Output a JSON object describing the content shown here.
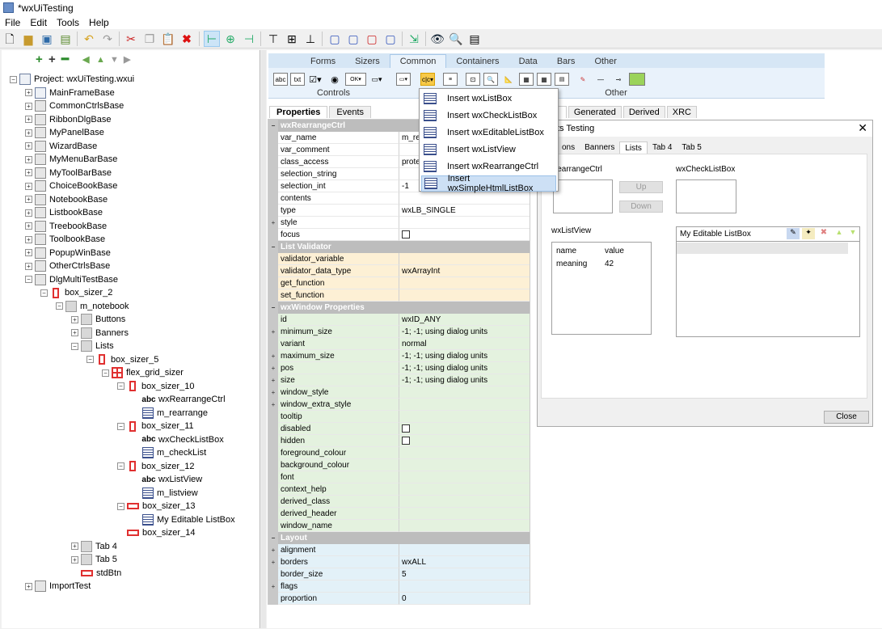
{
  "window": {
    "title": "*wxUiTesting"
  },
  "menu": [
    "File",
    "Edit",
    "Tools",
    "Help"
  ],
  "tree": [
    {
      "label": "Project: wxUiTesting.wxui",
      "depth": 0,
      "exp": "-",
      "icon": "form2"
    },
    {
      "label": "MainFrameBase",
      "depth": 1,
      "exp": "+",
      "icon": "form2"
    },
    {
      "label": "CommonCtrlsBase",
      "depth": 1,
      "exp": "+",
      "icon": "form"
    },
    {
      "label": "RibbonDlgBase",
      "depth": 1,
      "exp": "+",
      "icon": "form"
    },
    {
      "label": "MyPanelBase",
      "depth": 1,
      "exp": "+",
      "icon": "form"
    },
    {
      "label": "WizardBase",
      "depth": 1,
      "exp": "+",
      "icon": "form"
    },
    {
      "label": "MyMenuBarBase",
      "depth": 1,
      "exp": "+",
      "icon": "form"
    },
    {
      "label": "MyToolBarBase",
      "depth": 1,
      "exp": "+",
      "icon": "form"
    },
    {
      "label": "ChoiceBookBase",
      "depth": 1,
      "exp": "+",
      "icon": "form"
    },
    {
      "label": "NotebookBase",
      "depth": 1,
      "exp": "+",
      "icon": "form"
    },
    {
      "label": "ListbookBase",
      "depth": 1,
      "exp": "+",
      "icon": "form"
    },
    {
      "label": "TreebookBase",
      "depth": 1,
      "exp": "+",
      "icon": "form"
    },
    {
      "label": "ToolbookBase",
      "depth": 1,
      "exp": "+",
      "icon": "form"
    },
    {
      "label": "PopupWinBase",
      "depth": 1,
      "exp": "+",
      "icon": "form"
    },
    {
      "label": "OtherCtrlsBase",
      "depth": 1,
      "exp": "+",
      "icon": "form"
    },
    {
      "label": "DlgMultiTestBase",
      "depth": 1,
      "exp": "-",
      "icon": "form"
    },
    {
      "label": "box_sizer_2",
      "depth": 2,
      "exp": "-",
      "icon": "sizer"
    },
    {
      "label": "m_notebook",
      "depth": 3,
      "exp": "-",
      "icon": "folder"
    },
    {
      "label": "Buttons",
      "depth": 4,
      "exp": "+",
      "icon": "folder"
    },
    {
      "label": "Banners",
      "depth": 4,
      "exp": "+",
      "icon": "folder"
    },
    {
      "label": "Lists",
      "depth": 4,
      "exp": "-",
      "icon": "folder"
    },
    {
      "label": "box_sizer_5",
      "depth": 5,
      "exp": "-",
      "icon": "sizer"
    },
    {
      "label": "flex_grid_sizer",
      "depth": 6,
      "exp": "-",
      "icon": "grid"
    },
    {
      "label": "box_sizer_10",
      "depth": 7,
      "exp": "-",
      "icon": "sizer"
    },
    {
      "label": "wxRearrangeCtrl",
      "depth": 8,
      "exp": "",
      "icon": "abc"
    },
    {
      "label": "m_rearrange",
      "depth": 8,
      "exp": "",
      "icon": "list"
    },
    {
      "label": "box_sizer_11",
      "depth": 7,
      "exp": "-",
      "icon": "sizer"
    },
    {
      "label": "wxCheckListBox",
      "depth": 8,
      "exp": "",
      "icon": "abc"
    },
    {
      "label": "m_checkList",
      "depth": 8,
      "exp": "",
      "icon": "list"
    },
    {
      "label": "box_sizer_12",
      "depth": 7,
      "exp": "-",
      "icon": "sizer"
    },
    {
      "label": "wxListView",
      "depth": 8,
      "exp": "",
      "icon": "abc"
    },
    {
      "label": "m_listview",
      "depth": 8,
      "exp": "",
      "icon": "list"
    },
    {
      "label": "box_sizer_13",
      "depth": 7,
      "exp": "-",
      "icon": "hsizer"
    },
    {
      "label": "My Editable ListBox",
      "depth": 8,
      "exp": "",
      "icon": "list"
    },
    {
      "label": "box_sizer_14",
      "depth": 7,
      "exp": "",
      "icon": "hsizer"
    },
    {
      "label": "Tab 4",
      "depth": 4,
      "exp": "+",
      "icon": "folder"
    },
    {
      "label": "Tab 5",
      "depth": 4,
      "exp": "+",
      "icon": "folder"
    },
    {
      "label": "stdBtn",
      "depth": 4,
      "exp": "",
      "icon": "hsizer"
    },
    {
      "label": "ImportTest",
      "depth": 1,
      "exp": "+",
      "icon": "form"
    }
  ],
  "palette": {
    "tabs": [
      "Forms",
      "Sizers",
      "Common",
      "Containers",
      "Data",
      "Bars",
      "Other"
    ],
    "selected": "Common",
    "groups": [
      "Controls",
      "Other"
    ]
  },
  "prop_tabs": [
    "Properties",
    "Events"
  ],
  "props": [
    {
      "cat": "wxRearrangeCtrl"
    },
    {
      "n": "var_name",
      "v": "m_rea",
      "bg": "#fff"
    },
    {
      "n": "var_comment",
      "v": "",
      "bg": "#fff"
    },
    {
      "n": "class_access",
      "v": "protec",
      "bg": "#fff"
    },
    {
      "n": "selection_string",
      "v": "",
      "bg": "#fff"
    },
    {
      "n": "selection_int",
      "v": "-1",
      "bg": "#fff"
    },
    {
      "n": "contents",
      "v": "",
      "bg": "#fff"
    },
    {
      "n": "type",
      "v": "wxLB_SINGLE",
      "bg": "#fff"
    },
    {
      "n": "style",
      "v": "",
      "bg": "#fff",
      "g": "+"
    },
    {
      "n": "focus",
      "v": "",
      "bg": "#fff",
      "chk": true
    },
    {
      "cat": "List Validator"
    },
    {
      "n": "validator_variable",
      "v": "",
      "bg": "#fdf0d5"
    },
    {
      "n": "validator_data_type",
      "v": "wxArrayInt",
      "bg": "#fdf0d5"
    },
    {
      "n": "get_function",
      "v": "",
      "bg": "#fdf0d5"
    },
    {
      "n": "set_function",
      "v": "",
      "bg": "#fdf0d5"
    },
    {
      "cat": "wxWindow Properties"
    },
    {
      "n": "id",
      "v": "wxID_ANY",
      "bg": "#e4f2df"
    },
    {
      "n": "minimum_size",
      "v": "-1; -1; using dialog units",
      "bg": "#e4f2df",
      "g": "+"
    },
    {
      "n": "variant",
      "v": "normal",
      "bg": "#e4f2df"
    },
    {
      "n": "maximum_size",
      "v": "-1; -1; using dialog units",
      "bg": "#e4f2df",
      "g": "+"
    },
    {
      "n": "pos",
      "v": "-1; -1; using dialog units",
      "bg": "#e4f2df",
      "g": "+"
    },
    {
      "n": "size",
      "v": "-1; -1; using dialog units",
      "bg": "#e4f2df",
      "g": "+"
    },
    {
      "n": "window_style",
      "v": "",
      "bg": "#e4f2df",
      "g": "+"
    },
    {
      "n": "window_extra_style",
      "v": "",
      "bg": "#e4f2df",
      "g": "+"
    },
    {
      "n": "tooltip",
      "v": "",
      "bg": "#e4f2df"
    },
    {
      "n": "disabled",
      "v": "",
      "bg": "#e4f2df",
      "chk": true
    },
    {
      "n": "hidden",
      "v": "",
      "bg": "#e4f2df",
      "chk": true
    },
    {
      "n": "foreground_colour",
      "v": "",
      "bg": "#e4f2df"
    },
    {
      "n": "background_colour",
      "v": "",
      "bg": "#e4f2df"
    },
    {
      "n": "font",
      "v": "",
      "bg": "#e4f2df"
    },
    {
      "n": "context_help",
      "v": "",
      "bg": "#e4f2df"
    },
    {
      "n": "derived_class",
      "v": "",
      "bg": "#e4f2df"
    },
    {
      "n": "derived_header",
      "v": "",
      "bg": "#e4f2df"
    },
    {
      "n": "window_name",
      "v": "",
      "bg": "#e4f2df"
    },
    {
      "cat": "Layout"
    },
    {
      "n": "alignment",
      "v": "",
      "bg": "#e3f1f8",
      "g": "+"
    },
    {
      "n": "borders",
      "v": "wxALL",
      "bg": "#e3f1f8",
      "g": "+"
    },
    {
      "n": "border_size",
      "v": "5",
      "bg": "#e3f1f8"
    },
    {
      "n": "flags",
      "v": "",
      "bg": "#e3f1f8",
      "g": "+"
    },
    {
      "n": "proportion",
      "v": "0",
      "bg": "#e3f1f8"
    }
  ],
  "preview_tabs": [
    "ck Up",
    "Generated",
    "Derived",
    "XRC"
  ],
  "dialog": {
    "title": "ts Testing",
    "tabs": [
      "ons",
      "Banners",
      "Lists",
      "Tab 4",
      "Tab 5"
    ],
    "selected_tab": "Lists",
    "rearrange_label": "RearrangeCtrl",
    "up": "Up",
    "down": "Down",
    "checklist_label": "wxCheckListBox",
    "listview_label": "wxListView",
    "lv_rows": [
      [
        "name",
        "value"
      ],
      [
        "meaning",
        "42"
      ]
    ],
    "editable_label": "My Editable ListBox",
    "close": "Close"
  },
  "dropdown": [
    "Insert wxListBox",
    "Insert wxCheckListBox",
    "Insert wxEditableListBox",
    "Insert wxListView",
    "Insert wxRearrangeCtrl",
    "Insert wxSimpleHtmlListBox"
  ],
  "dropdown_highlight": "Insert wxSimpleHtmlListBox"
}
